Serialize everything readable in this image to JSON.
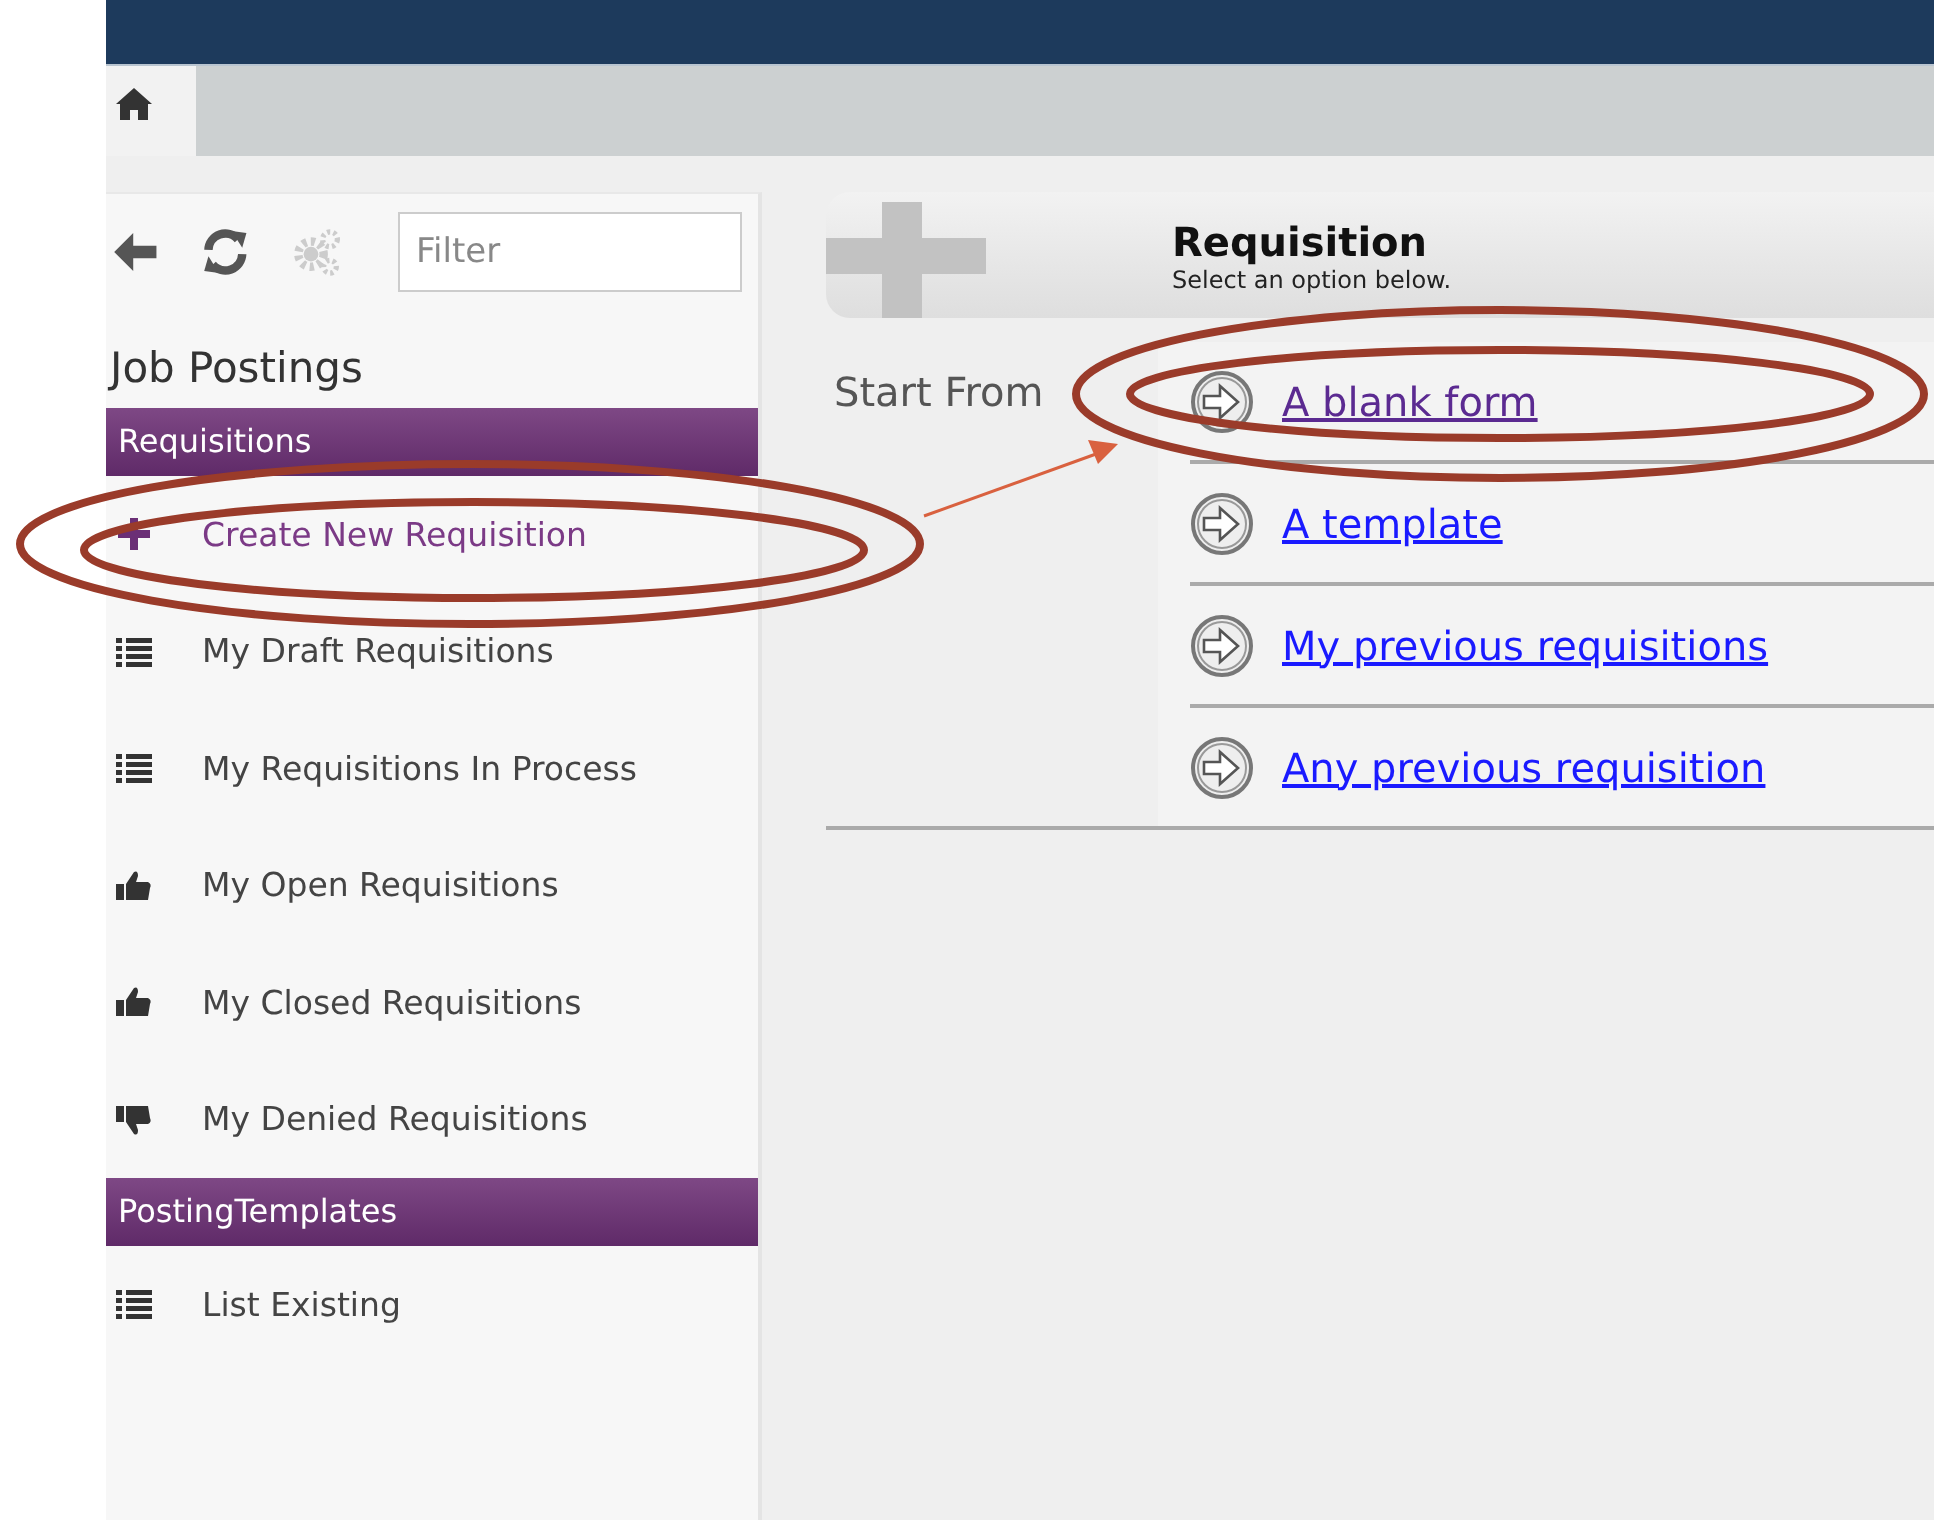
{
  "tabs": [
    {
      "kind": "home",
      "selected": true
    }
  ],
  "sidebar": {
    "filter": {
      "placeholder": "Filter"
    },
    "title": "Job Postings",
    "sections": [
      {
        "title": "Requisitions",
        "items": [
          {
            "label": "Create New Requisition",
            "kind": "plus",
            "selected": true
          },
          {
            "label": "My Draft Requisitions",
            "kind": "list",
            "selected": false
          },
          {
            "label": "My Requisitions In Process",
            "kind": "list",
            "selected": false
          },
          {
            "label": "My Open Requisitions",
            "kind": "thumbs-up",
            "selected": false
          },
          {
            "label": "My Closed Requisitions",
            "kind": "thumbs-up",
            "selected": false
          },
          {
            "label": "My Denied Requisitions",
            "kind": "thumbs-down",
            "selected": false
          }
        ]
      },
      {
        "title": "PostingTemplates",
        "items": [
          {
            "label": "List Existing",
            "kind": "list",
            "selected": false
          }
        ]
      }
    ]
  },
  "panel": {
    "title": "Requisition",
    "subtitle": "Select an option below.",
    "start_label": "Start From",
    "options": [
      {
        "label": "A blank form",
        "visited": true
      },
      {
        "label": "A template",
        "visited": false
      },
      {
        "label": "My previous requisitions",
        "visited": false
      },
      {
        "label": "Any previous requisition",
        "visited": false
      }
    ]
  }
}
